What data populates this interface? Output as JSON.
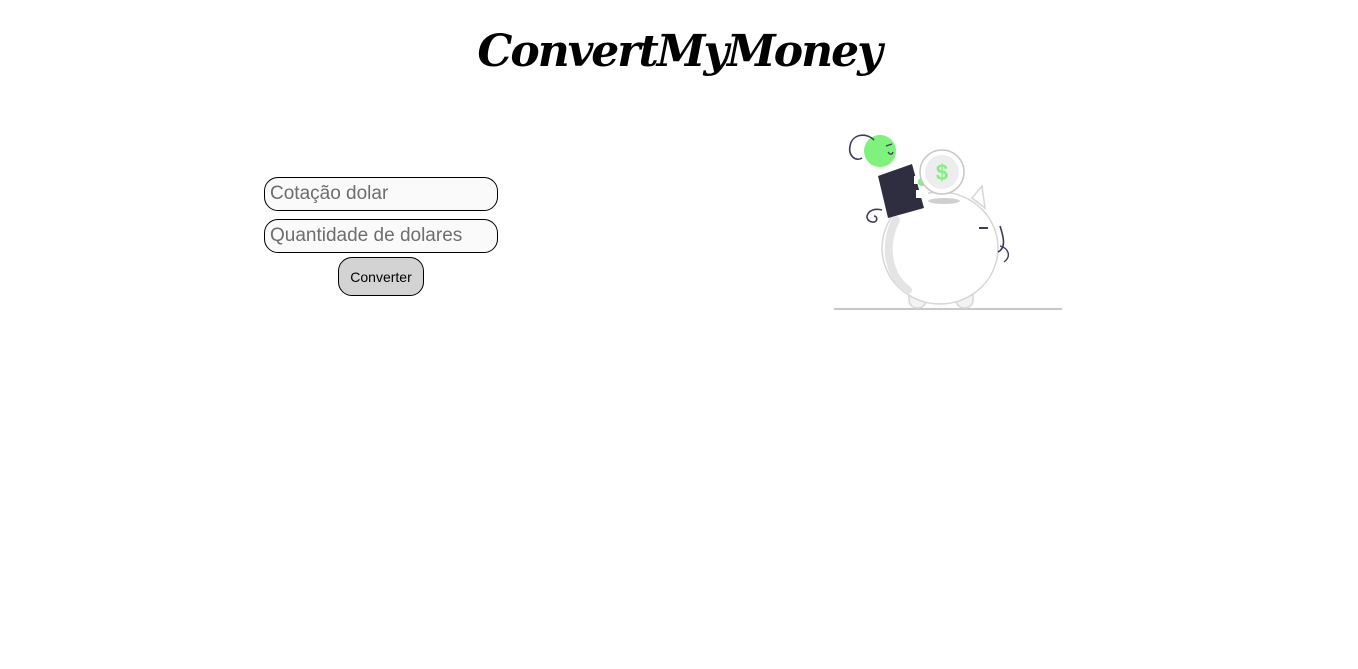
{
  "header": {
    "title": "ConvertMyMoney"
  },
  "form": {
    "rate_placeholder": "Cotação dolar",
    "amount_placeholder": "Quantidade de dolares",
    "submit_label": "Converter"
  },
  "illustration": {
    "coin_symbol": "$",
    "accent_color": "#7ef27a",
    "dark_color": "#2f2e41"
  }
}
